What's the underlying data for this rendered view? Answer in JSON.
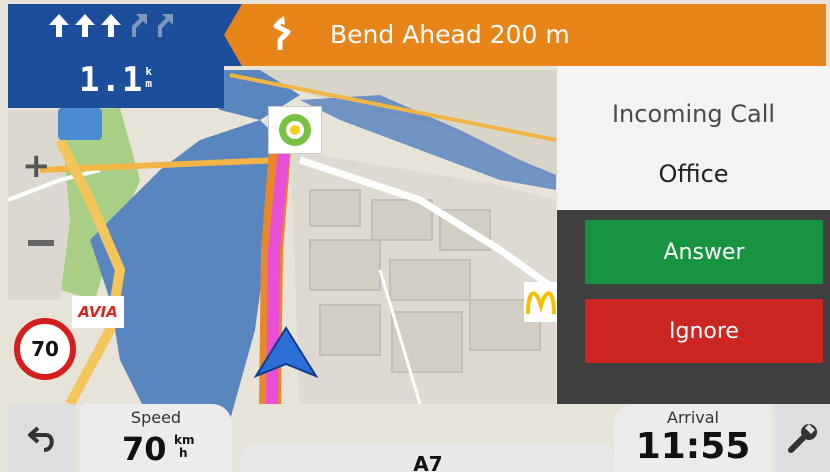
{
  "turn": {
    "distance_value": "1.1",
    "distance_unit_top": "k",
    "distance_unit_bottom": "m",
    "lanes": [
      "straight-arrow-icon",
      "straight-arrow-icon",
      "straight-arrow-icon",
      "slight-right-arrow-icon-dim",
      "slight-right-arrow-icon-dim"
    ]
  },
  "warning": {
    "icon": "bend-warning-icon",
    "text": "Bend Ahead 200 m"
  },
  "call": {
    "title": "Incoming Call",
    "caller": "Office",
    "answer_label": "Answer",
    "ignore_label": "Ignore"
  },
  "speed": {
    "label": "Speed",
    "value": "70",
    "unit_top": "km",
    "unit_bottom": "h"
  },
  "road": {
    "name": "A7"
  },
  "arrival": {
    "label": "Arrival",
    "time": "11:55"
  },
  "map": {
    "speed_limit": "70",
    "avia_logo": "AVIA",
    "zoom_in_icon": "plus-icon",
    "zoom_out_icon": "minus-icon"
  },
  "colors": {
    "turn_panel": "#1d4e9c",
    "warning_banner": "#e7851a",
    "answer": "#17943f",
    "ignore": "#cc2622",
    "route": "#e94ed6"
  }
}
